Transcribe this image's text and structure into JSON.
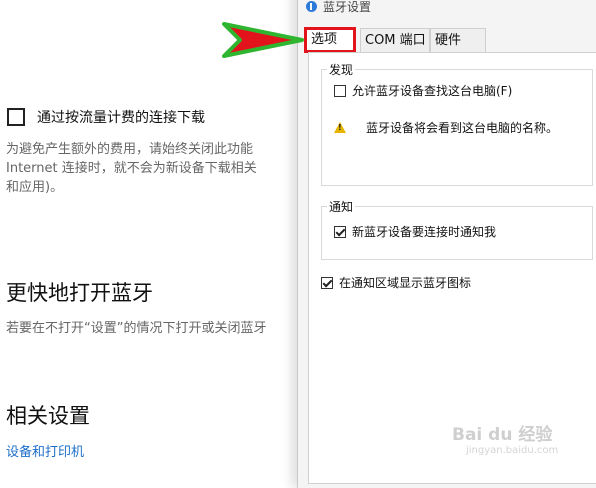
{
  "left_page": {
    "metered_checkbox_label": "通过按流量计费的连接下载",
    "metered_description": [
      "为避免产生额外的费用，请始终关闭此功能",
      "Internet 连接时，就不会为新设备下载相关",
      "和应用)。"
    ],
    "open_heading": "更快地打开蓝牙",
    "open_description": "若要在不打开“设置”的情况下打开或关闭蓝牙",
    "related_heading": "相关设置",
    "devices_link": "设备和打印机"
  },
  "dialog": {
    "title": "蓝牙设置",
    "tabs": [
      "选项",
      "COM 端口",
      "硬件"
    ],
    "discovery": {
      "legend": "发现",
      "allow_label": "允许蓝牙设备查找这台电脑(F)",
      "allow_checked": false,
      "warning_text": "蓝牙设备将会看到这台电脑的名称。"
    },
    "notifications": {
      "legend": "通知",
      "notify_label": "新蓝牙设备要连接时通知我",
      "notify_checked": true
    },
    "tray_icon_label": "在通知区域显示蓝牙图标",
    "tray_icon_checked": true
  },
  "watermark": {
    "text": "Bai du 经验",
    "sub": "jingyan.baidu.com"
  },
  "colors": {
    "highlight_box": "#e3131b",
    "arrow_fill": "#e3131b",
    "arrow_outline": "#2fb52f",
    "link": "#1e6fc9"
  }
}
